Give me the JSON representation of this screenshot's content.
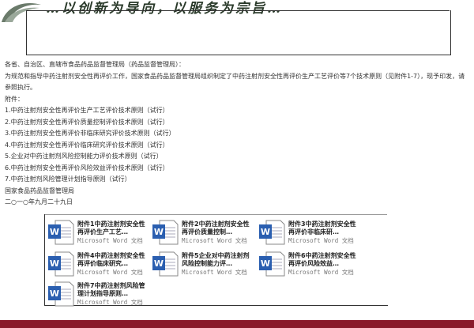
{
  "banner": {
    "text": "…以创新为导向，以服务为宗旨…"
  },
  "letter": {
    "recipient": "各省、自治区、直辖市食品药品监督管理局（药品监督管理局）：",
    "body": "为规范和指导中药注射剂安全性再评价工作，国家食品药品监督管理局组织制定了中药注射剂安全性再评价生产工艺评价等7个技术原则（见附件1-7），现予印发，请参照执行。",
    "attachments_label": "附件：",
    "attachments": [
      "1.中药注射剂安全性再评价生产工艺评价技术原则（试行）",
      "2.中药注射剂安全性再评价质量控制评价技术原则（试行）",
      "3.中药注射剂安全性再评价非临床研究评价技术原则（试行）",
      "4.中药注射剂安全性再评价临床研究评价技术原则（试行）",
      "5.企业对中药注射剂风险控制能力评价技术原则（试行）",
      "6.中药注射剂安全性再评价风险效益评价技术原则（试行）",
      "7.中药注射剂风险管理计划指导原则（试行）"
    ],
    "signature": "国家食品药品监督管理局",
    "date": "二○一○年九月二十九日"
  },
  "files": [
    {
      "name": "附件1中药注射剂安全性再评价生产工艺…",
      "type": "Microsoft Word 文档"
    },
    {
      "name": "附件2中药注射剂安全性再评价质量控制…",
      "type": "Microsoft Word 文档"
    },
    {
      "name": "附件3中药注射剂安全性再评价非临床研…",
      "type": "Microsoft Word 文档"
    },
    {
      "name": "附件4中药注射剂安全性再评价临床研究…",
      "type": "Microsoft Word 文档"
    },
    {
      "name": "附件5企业对中药注射剂风险控制能力评…",
      "type": "Microsoft Word 文档"
    },
    {
      "name": "附件6中药注射剂安全性再评价风险效益…",
      "type": "Microsoft Word 文档"
    },
    {
      "name": "附件7中药注射剂风险管理计划指导原则…",
      "type": "Microsoft Word 文档"
    }
  ],
  "colors": {
    "footer": "#8a1a2a",
    "icon_blue": "#2b5fb0"
  }
}
